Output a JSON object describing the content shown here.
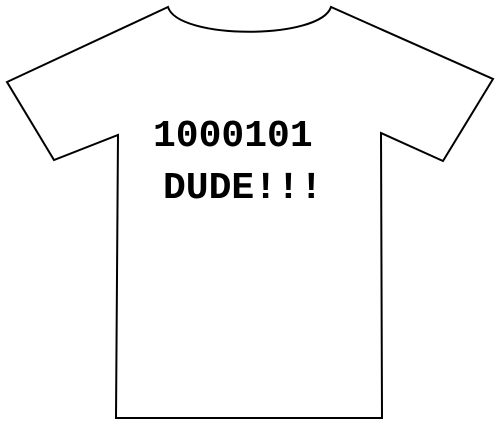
{
  "shirt": {
    "line1": "1000101",
    "line2": "DUDE!!!",
    "fill_color": "#ffffff",
    "outline_color": "#000000",
    "text_color": "#000000"
  }
}
